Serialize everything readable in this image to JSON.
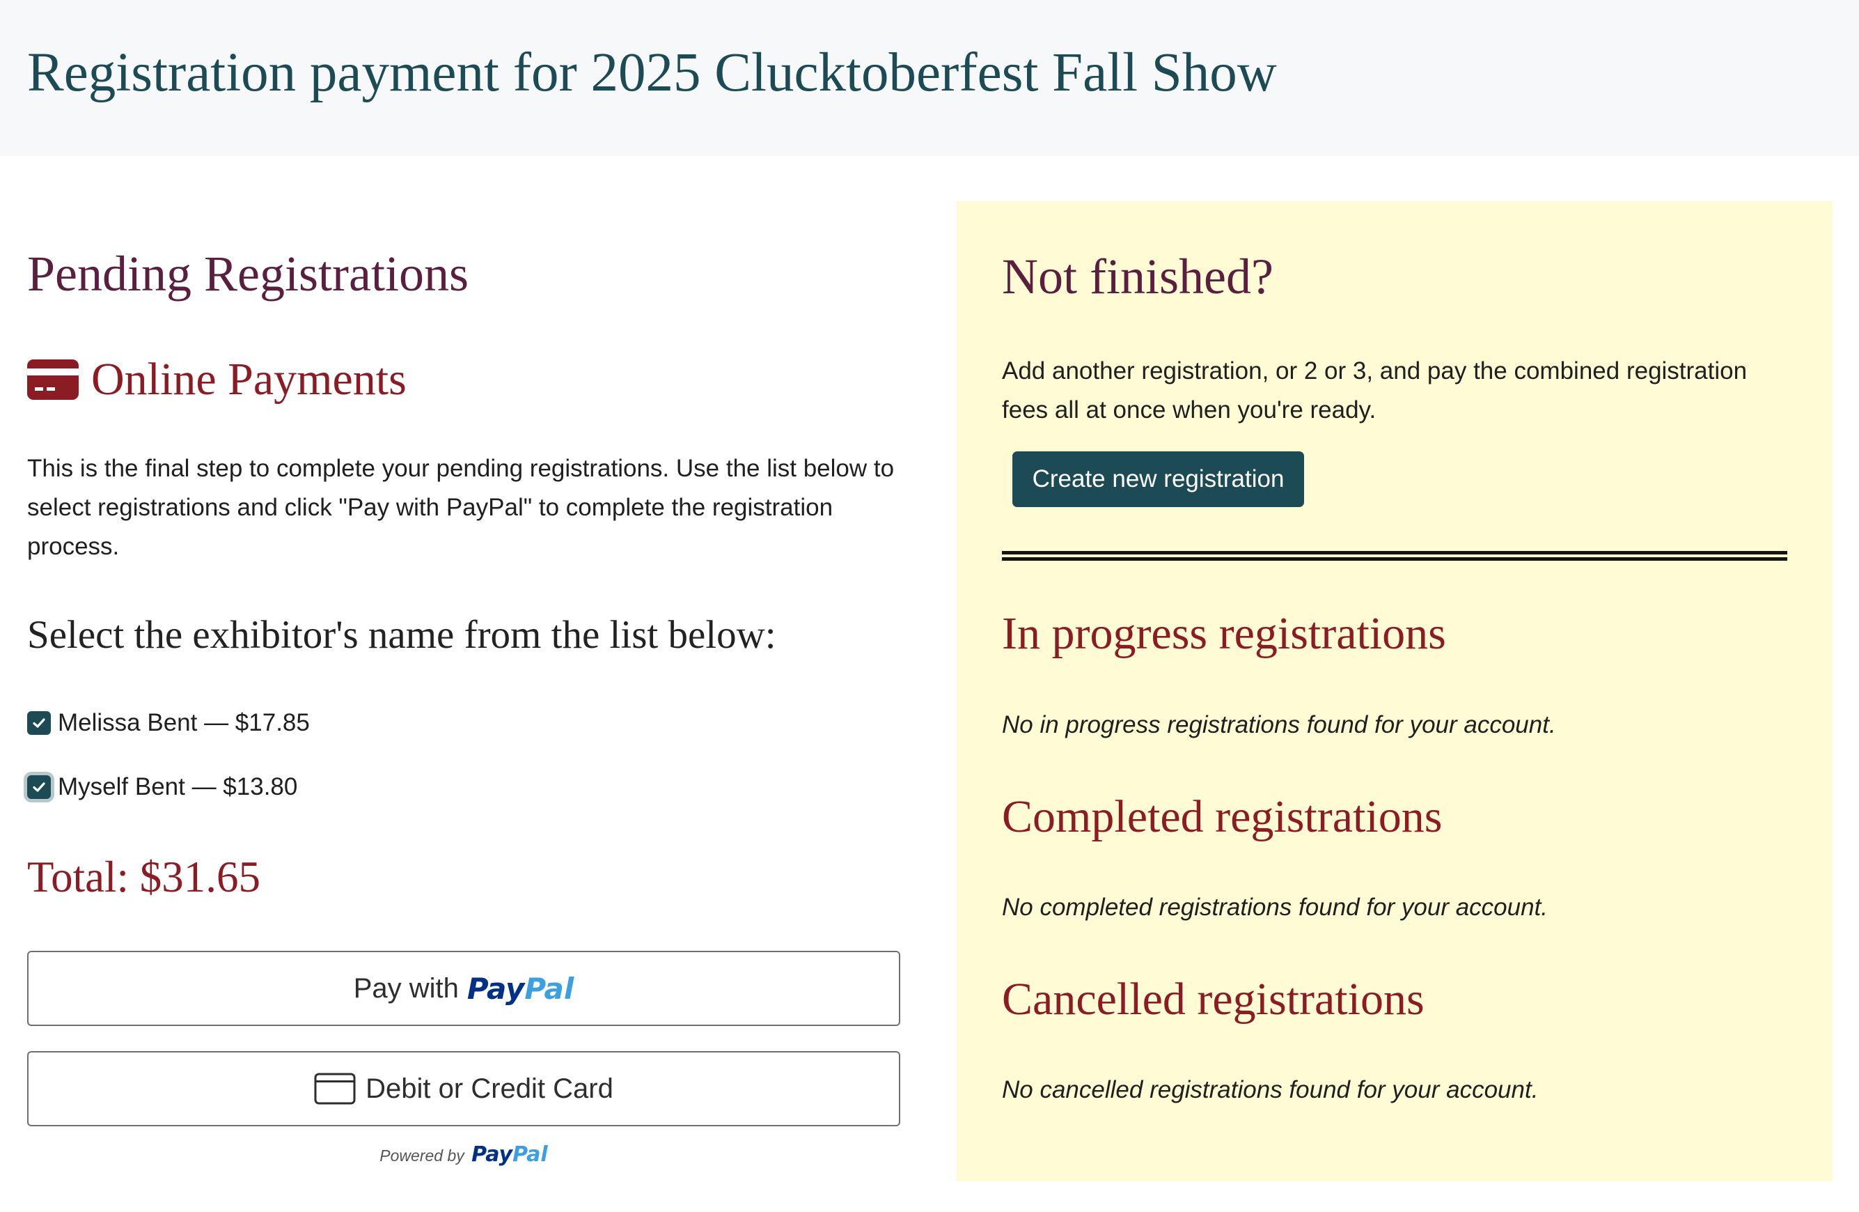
{
  "header": {
    "title": "Registration payment for 2025 Clucktoberfest Fall Show"
  },
  "left": {
    "heading": "Pending Registrations",
    "online_payments": {
      "icon": "credit-card-icon",
      "title": "Online Payments"
    },
    "intro": "This is the final step to complete your pending registrations. Use the list below to select registrations and click \"Pay with PayPal\" to complete the registration process.",
    "select_heading": "Select the exhibitor's name from the list below:",
    "exhibitors": [
      {
        "label": "Melissa Bent — $17.85",
        "checked": true
      },
      {
        "label": "Myself Bent — $13.80",
        "checked": true
      }
    ],
    "total": "Total: $31.65",
    "paypal_button": {
      "prefix": "Pay with",
      "brand_dark": "Pay",
      "brand_light": "Pal"
    },
    "card_button": {
      "label": "Debit or Credit Card"
    },
    "powered_by": {
      "prefix": "Powered by",
      "brand_dark": "Pay",
      "brand_light": "Pal"
    }
  },
  "right": {
    "heading": "Not finished?",
    "text": "Add another registration, or 2 or 3, and pay the combined registration fees all at once when you're ready.",
    "create_button": "Create new registration",
    "sections": [
      {
        "title": "In progress registrations",
        "empty": "No in progress registrations found for your account."
      },
      {
        "title": "Completed registrations",
        "empty": "No completed registrations found for your account."
      },
      {
        "title": "Cancelled registrations",
        "empty": "No cancelled registrations found for your account."
      }
    ]
  },
  "colors": {
    "header_bg": "#f7f8f9",
    "title_teal": "#1c4a55",
    "heading_plum": "#5a1f3e",
    "accent_red": "#8b1c24",
    "panel_yellow": "#fffbd4",
    "paypal_dark": "#003087",
    "paypal_light": "#3b9fe0"
  }
}
